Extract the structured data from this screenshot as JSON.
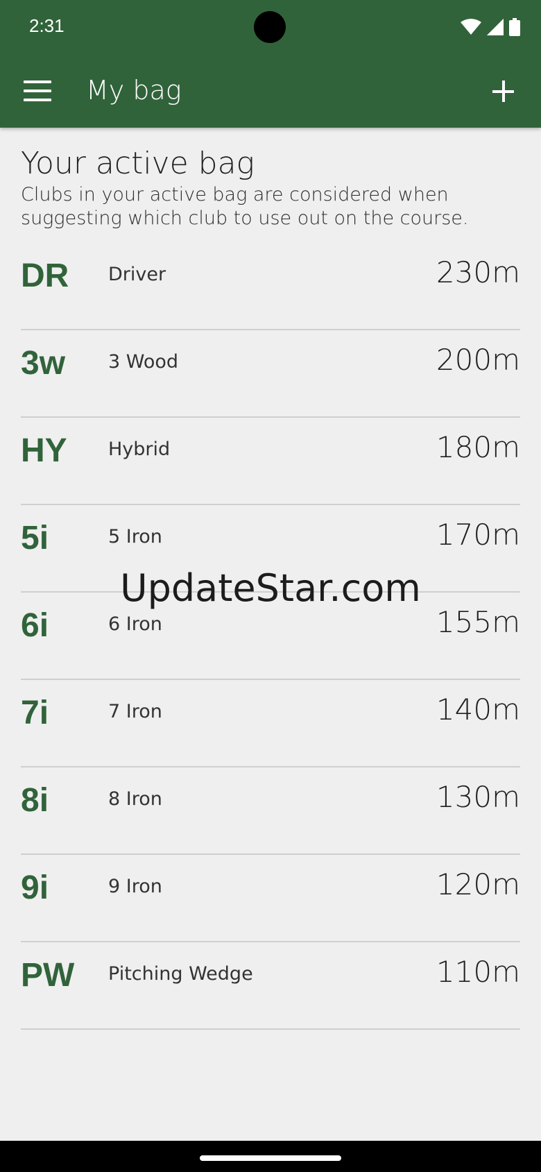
{
  "status_bar": {
    "time": "2:31",
    "icons": [
      "wifi-icon",
      "cellular-icon",
      "battery-icon"
    ]
  },
  "app_bar": {
    "title": "My bag",
    "menu_icon": "hamburger-menu-icon",
    "add_icon": "plus-icon",
    "background_color": "#31633a"
  },
  "content": {
    "heading": "Your active bag",
    "description": "Clubs in your active bag are considered when suggesting which club to use out on the course."
  },
  "clubs": [
    {
      "abbr": "DR",
      "name": "Driver",
      "distance": "230m"
    },
    {
      "abbr": "3w",
      "name": "3 Wood",
      "distance": "200m"
    },
    {
      "abbr": "HY",
      "name": "Hybrid",
      "distance": "180m"
    },
    {
      "abbr": "5i",
      "name": "5 Iron",
      "distance": "170m"
    },
    {
      "abbr": "6i",
      "name": "6 Iron",
      "distance": "155m"
    },
    {
      "abbr": "7i",
      "name": "7 Iron",
      "distance": "140m"
    },
    {
      "abbr": "8i",
      "name": "8 Iron",
      "distance": "130m"
    },
    {
      "abbr": "9i",
      "name": "9 Iron",
      "distance": "120m"
    },
    {
      "abbr": "PW",
      "name": "Pitching Wedge",
      "distance": "110m"
    }
  ],
  "watermark": "UpdateStar.com"
}
